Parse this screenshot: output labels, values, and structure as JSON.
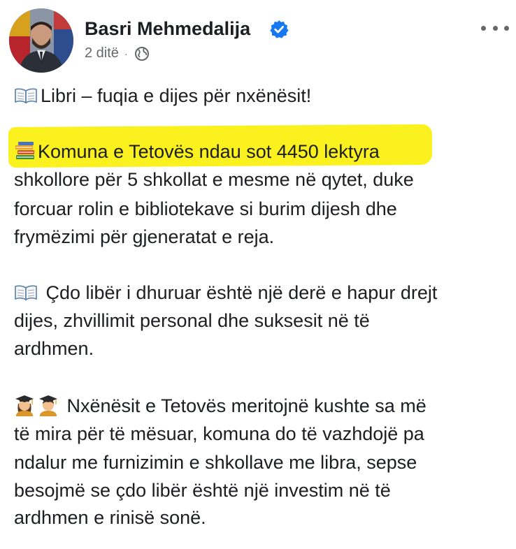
{
  "post": {
    "author_name": "Basri Mehmedalija",
    "time": "2 ditë",
    "separator": "·",
    "privacy_icon": "globe-icon",
    "verified_icon": "verified-badge-icon",
    "more_icon": "more-options-icon",
    "highlight_color": "#fbf11e",
    "verified_color": "#1877f2",
    "lines": {
      "p1_l1": "Libri – fuqia e dijes për nxënësit!",
      "p2_l1": "Komuna e Tetovës ndau sot 4450 lektyra",
      "p2_l2": "shkollore për 5 shkollat e mesme në qytet, duke",
      "p2_l3": "forcuar rolin e bibliotekave si burim dijesh dhe",
      "p2_l4": "frymëzimi për gjeneratat e reja.",
      "p3_l1": " Çdo libër i dhuruar është një derë e hapur drejt",
      "p3_l2": "dijes, zhvillimit personal dhe suksesit në të",
      "p3_l3": "ardhmen.",
      "p4_l1": " Nxënësit e Tetovës meritojnë kushte sa më",
      "p4_l2": "të mira për të mësuar, komuna do të vazhdojë pa",
      "p4_l3": "ndalur me furnizimin e shkollave me libra, sepse",
      "p4_l4": "besojmë se çdo libër është një investim në të",
      "p4_l5": "ardhmen e rinisë sonë."
    },
    "emoji_names": {
      "open_book": "open-book-emoji",
      "books": "books-emoji",
      "woman_student": "woman-student-emoji",
      "man_student": "man-student-emoji"
    }
  }
}
